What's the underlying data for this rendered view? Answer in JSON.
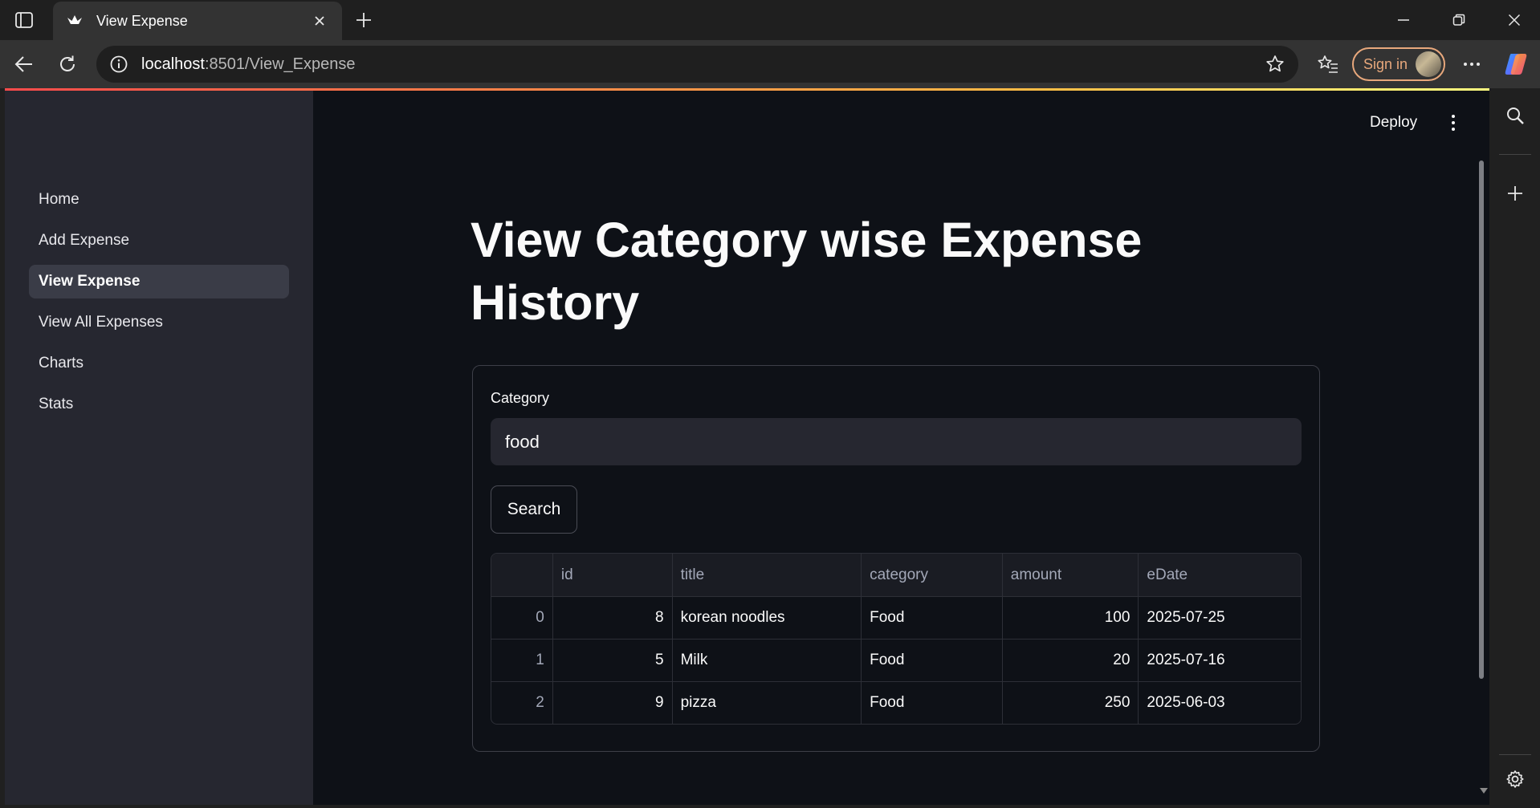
{
  "browser": {
    "tab_title": "View Expense",
    "url_host": "localhost",
    "url_rest": ":8501/View_Expense",
    "signin_label": "Sign in"
  },
  "sidebar": {
    "items": [
      {
        "label": "Home",
        "active": false
      },
      {
        "label": "Add Expense",
        "active": false
      },
      {
        "label": "View Expense",
        "active": true
      },
      {
        "label": "View All Expenses",
        "active": false
      },
      {
        "label": "Charts",
        "active": false
      },
      {
        "label": "Stats",
        "active": false
      }
    ]
  },
  "header": {
    "deploy_label": "Deploy"
  },
  "main": {
    "title": "View Category wise Expense History",
    "category_label": "Category",
    "category_value": "food",
    "search_label": "Search",
    "table": {
      "columns": [
        "",
        "id",
        "title",
        "category",
        "amount",
        "eDate"
      ],
      "rows": [
        [
          "0",
          "8",
          "korean noodles",
          "Food",
          "100",
          "2025-07-25"
        ],
        [
          "1",
          "5",
          "Milk",
          "Food",
          "20",
          "2025-07-16"
        ],
        [
          "2",
          "9",
          "pizza",
          "Food",
          "250",
          "2025-06-03"
        ]
      ]
    }
  },
  "colors": {
    "accent": "#ff4b4b",
    "page_bg": "#0e1117",
    "sidebar_bg": "#262730"
  }
}
